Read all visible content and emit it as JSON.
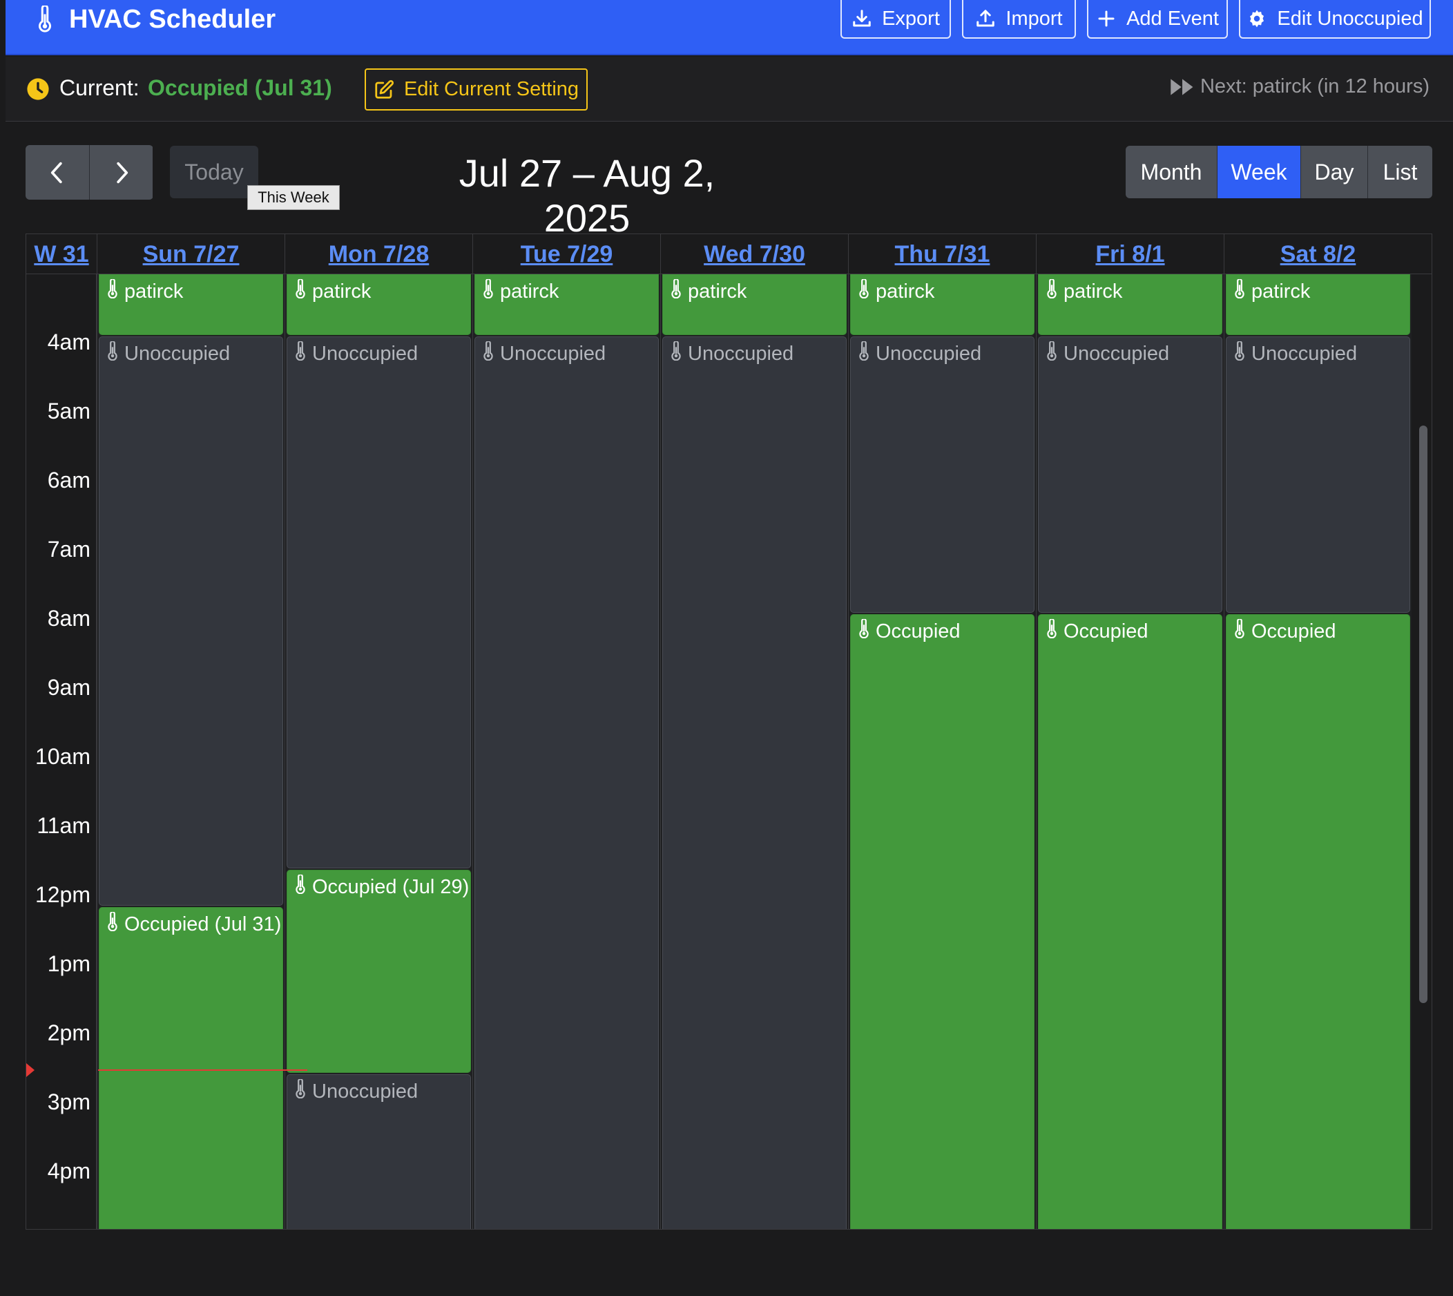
{
  "header": {
    "title": "HVAC Scheduler",
    "buttons": {
      "export": "Export",
      "import": "Import",
      "add_event": "Add Event",
      "edit_unoccupied": "Edit Unoccupied"
    }
  },
  "status": {
    "current_label": "Current:",
    "current_value": "Occupied (Jul 31)",
    "edit_current": "Edit Current Setting",
    "next": "Next: patirck (in 12 hours)"
  },
  "toolbar": {
    "today": "Today",
    "today_tooltip": "This Week",
    "range_title": "Jul 27 – Aug 2, 2025",
    "views": [
      "Month",
      "Week",
      "Day",
      "List"
    ],
    "active_view": "Week"
  },
  "calendar": {
    "week_label": "W 31",
    "days": [
      "Sun 7/27",
      "Mon 7/28",
      "Tue 7/29",
      "Wed 7/30",
      "Thu 7/31",
      "Fri 8/1",
      "Sat 8/2"
    ],
    "hours": [
      "4am",
      "5am",
      "6am",
      "7am",
      "8am",
      "9am",
      "10am",
      "11am",
      "12pm",
      "1pm",
      "2pm",
      "3pm",
      "4pm"
    ],
    "events": {
      "sun": [
        {
          "title": "patirck",
          "kind": "occupied"
        },
        {
          "title": "Unoccupied",
          "kind": "unoccupied"
        },
        {
          "title": "Occupied (Jul 31)",
          "kind": "occupied"
        }
      ],
      "mon": [
        {
          "title": "patirck",
          "kind": "occupied"
        },
        {
          "title": "Unoccupied",
          "kind": "unoccupied"
        },
        {
          "title": "Occupied (Jul 29)",
          "kind": "occupied"
        },
        {
          "title": "Unoccupied",
          "kind": "unoccupied"
        }
      ],
      "tue": [
        {
          "title": "patirck",
          "kind": "occupied"
        },
        {
          "title": "Unoccupied",
          "kind": "unoccupied"
        }
      ],
      "wed": [
        {
          "title": "patirck",
          "kind": "occupied"
        },
        {
          "title": "Unoccupied",
          "kind": "unoccupied"
        }
      ],
      "thu": [
        {
          "title": "patirck",
          "kind": "occupied"
        },
        {
          "title": "Unoccupied",
          "kind": "unoccupied"
        },
        {
          "title": "Occupied",
          "kind": "occupied"
        }
      ],
      "fri": [
        {
          "title": "patirck",
          "kind": "occupied"
        },
        {
          "title": "Unoccupied",
          "kind": "unoccupied"
        },
        {
          "title": "Occupied",
          "kind": "occupied"
        }
      ],
      "sat": [
        {
          "title": "patirck",
          "kind": "occupied"
        },
        {
          "title": "Unoccupied",
          "kind": "unoccupied"
        },
        {
          "title": "Occupied",
          "kind": "occupied"
        }
      ]
    }
  },
  "colors": {
    "brand": "#2f5ff5",
    "occupied": "#43993c",
    "unoccupied": "#33363d",
    "current_accent": "#4caf50",
    "edit_accent": "#f5c518",
    "now_indicator": "#e53935",
    "day_header_link": "#5b8df5"
  },
  "icons": {
    "app": "thermometer-icon",
    "export": "download-icon",
    "import": "upload-icon",
    "add": "plus-icon",
    "edit_unoccupied": "gear-icon",
    "current": "clock-icon",
    "edit": "edit-icon",
    "next": "fast-forward-icon",
    "event": "thermometer-icon"
  }
}
